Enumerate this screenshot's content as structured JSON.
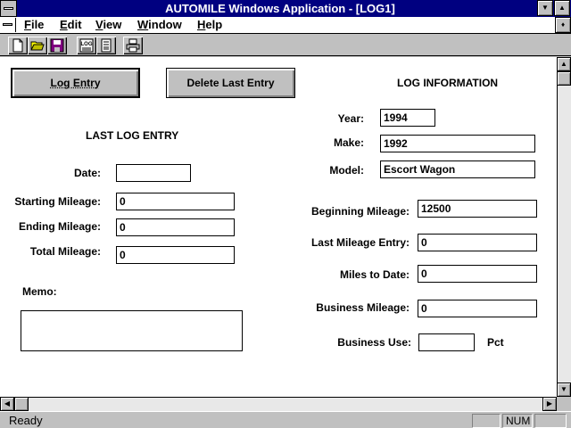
{
  "window": {
    "title": "AUTOMILE Windows Application - [LOG1]"
  },
  "menu": {
    "items": [
      {
        "accel": "F",
        "rest": "ile"
      },
      {
        "accel": "E",
        "rest": "dit"
      },
      {
        "accel": "V",
        "rest": "iew"
      },
      {
        "accel": "W",
        "rest": "indow"
      },
      {
        "accel": "H",
        "rest": "elp"
      }
    ]
  },
  "toolbar": {
    "icons": [
      "new-document-icon",
      "open-folder-icon",
      "save-disk-icon",
      "log-icon",
      "report-icon",
      "print-icon"
    ],
    "log_text": "LOG"
  },
  "buttons": {
    "log_entry": "Log Entry",
    "delete_last_entry": "Delete Last Entry"
  },
  "last_log": {
    "heading": "LAST LOG ENTRY",
    "date_label": "Date:",
    "date_value": "",
    "starting_mileage_label": "Starting Mileage:",
    "starting_mileage_value": "0",
    "ending_mileage_label": "Ending Mileage:",
    "ending_mileage_value": "0",
    "total_mileage_label": "Total Mileage:",
    "total_mileage_value": "0",
    "memo_label": "Memo:",
    "memo_value": ""
  },
  "log_info": {
    "heading": "LOG INFORMATION",
    "year_label": "Year:",
    "year_value": "1994",
    "make_label": "Make:",
    "make_value": "1992",
    "model_label": "Model:",
    "model_value": "Escort Wagon",
    "beginning_mileage_label": "Beginning Mileage:",
    "beginning_mileage_value": "12500",
    "last_mileage_entry_label": "Last Mileage Entry:",
    "last_mileage_entry_value": "0",
    "miles_to_date_label": "Miles to Date:",
    "miles_to_date_value": "0",
    "business_mileage_label": "Business Mileage:",
    "business_mileage_value": "0",
    "business_use_label": "Business Use:",
    "business_use_value": "",
    "business_use_unit": "Pct"
  },
  "status": {
    "text": "Ready",
    "num_indicator": "NUM"
  },
  "colors": {
    "title_bar": "#000080",
    "face": "#c0c0c0",
    "client": "#ffffff"
  }
}
